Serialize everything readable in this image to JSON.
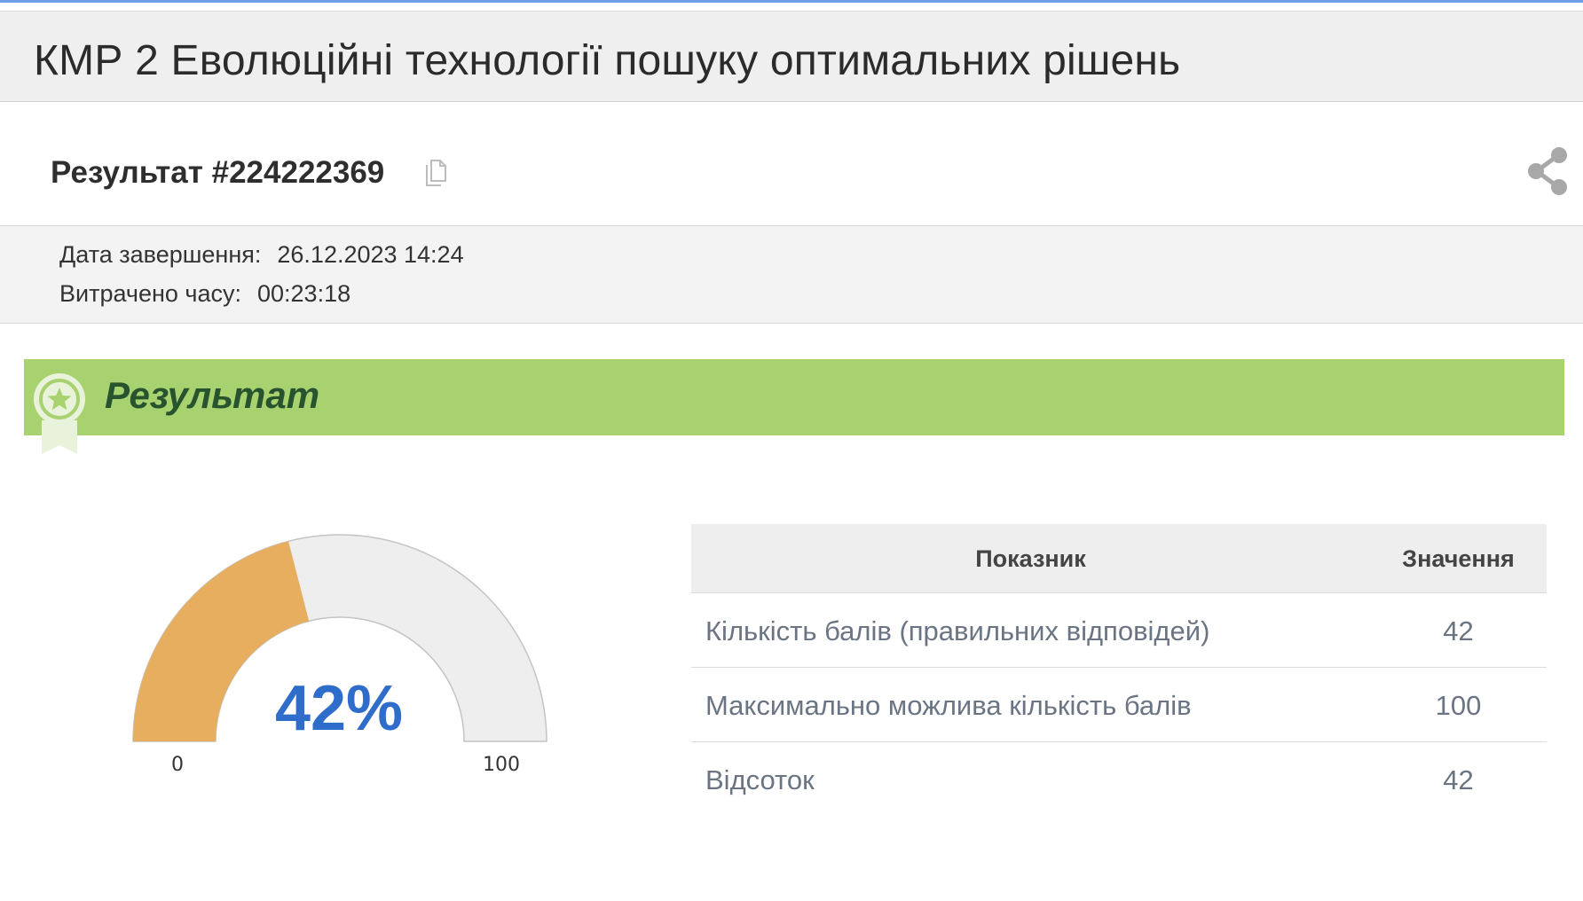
{
  "page": {
    "title": "КМР 2 Еволюційні технології пошуку оптимальних рішень"
  },
  "result": {
    "id_label": "Результат #224222369",
    "copy_icon": "copy-icon",
    "share_icon": "share-icon"
  },
  "meta": {
    "finished_label": "Дата завершення:",
    "finished_value": "26.12.2023 14:24",
    "spent_label": "Витрачено часу:",
    "spent_value": "00:23:18"
  },
  "banner": {
    "title": "Результат",
    "icon": "award-badge-icon",
    "color": "#a8d270",
    "title_color": "#28532f"
  },
  "gauge": {
    "percent_label": "42%",
    "value": 42,
    "min": 0,
    "max": 100,
    "min_label": "0",
    "max_label": "100",
    "fill_color": "#e6ae5e",
    "track_color": "#eeeeee",
    "text_color": "#2f6dcb"
  },
  "table": {
    "headers": [
      "Показник",
      "Значення"
    ],
    "rows": [
      {
        "label": "Кількість балів (правильних відповідей)",
        "value": "42"
      },
      {
        "label": "Максимально можлива кількість балів",
        "value": "100"
      },
      {
        "label": "Відсоток",
        "value": "42"
      }
    ]
  }
}
